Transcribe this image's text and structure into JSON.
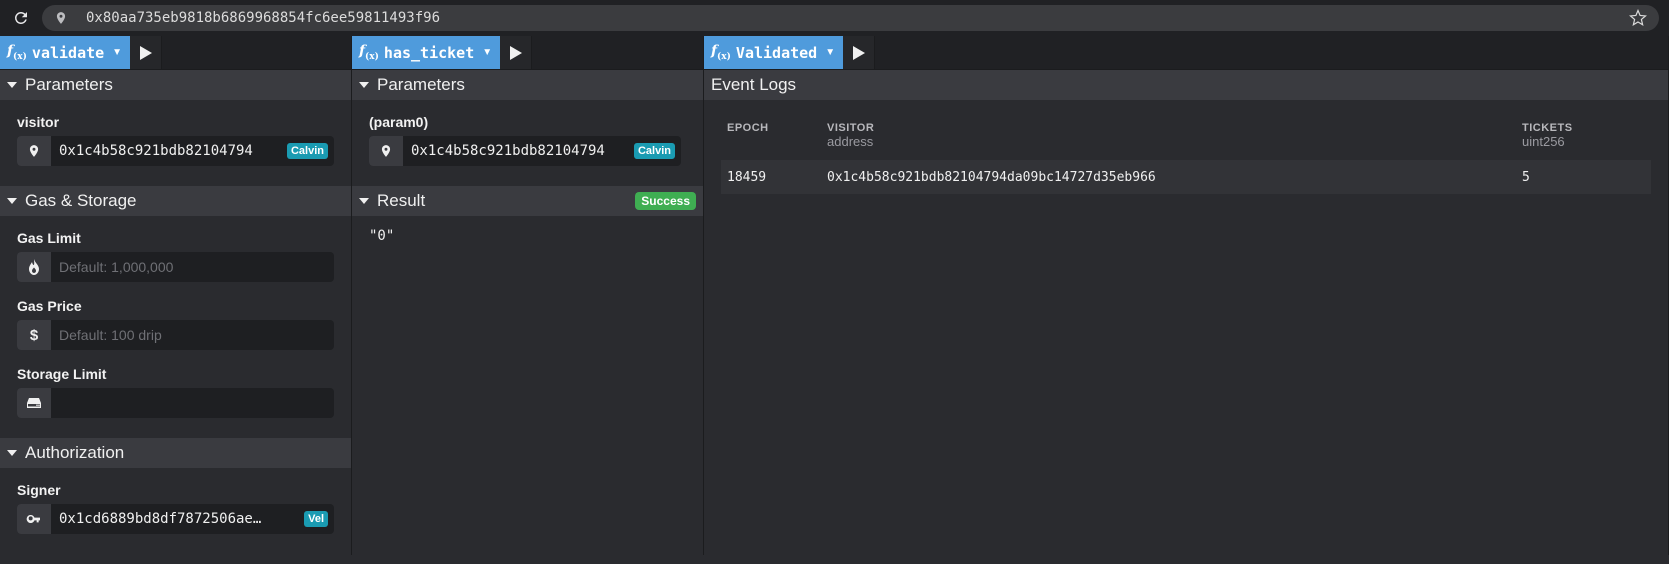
{
  "address_bar": {
    "url": "0x80aa735eb9818b6869968854fc6ee59811493f96"
  },
  "panels": [
    {
      "function_name": "validate",
      "sections": {
        "parameters": {
          "title": "Parameters",
          "visitor_label": "visitor",
          "visitor_value": "0x1c4b58c921bdb82104794",
          "visitor_tag": "Calvin"
        },
        "gas": {
          "title": "Gas & Storage",
          "gas_limit_label": "Gas Limit",
          "gas_limit_placeholder": "Default: 1,000,000",
          "gas_price_label": "Gas Price",
          "gas_price_placeholder": "Default: 100 drip",
          "storage_limit_label": "Storage Limit",
          "storage_limit_value": ""
        },
        "authorization": {
          "title": "Authorization",
          "signer_label": "Signer",
          "signer_value": "0x1cd6889bd8df7872506ae…",
          "signer_tag": "Vel"
        }
      }
    },
    {
      "function_name": "has_ticket",
      "sections": {
        "parameters": {
          "title": "Parameters",
          "param_label": "(param0)",
          "param_value": "0x1c4b58c921bdb82104794",
          "param_tag": "Calvin"
        },
        "result": {
          "title": "Result",
          "status": "Success",
          "value": "\"0\""
        }
      }
    },
    {
      "function_name": "Validated",
      "sections": {
        "event_logs": {
          "title": "Event Logs",
          "columns": [
            {
              "name": "EPOCH",
              "type": ""
            },
            {
              "name": "VISITOR",
              "type": "address"
            },
            {
              "name": "TICKETS",
              "type": "uint256"
            }
          ],
          "rows": [
            {
              "epoch": "18459",
              "visitor": "0x1c4b58c921bdb82104794da09bc14727d35eb966",
              "tickets": "5"
            }
          ]
        }
      }
    }
  ],
  "icons": {
    "refresh": "refresh-icon",
    "location": "location-pin-icon",
    "star": "star-icon",
    "play": "play-icon",
    "flame": "flame-icon",
    "dollar": "dollar-icon",
    "storage": "storage-drive-icon",
    "key": "key-icon"
  },
  "colors": {
    "accent": "#4f9bdc",
    "success": "#3fae52",
    "tag": "#1a9bb2"
  }
}
